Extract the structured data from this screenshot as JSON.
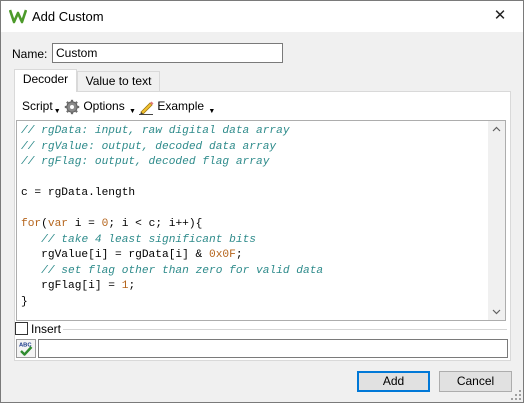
{
  "window": {
    "title": "Add Custom",
    "close_glyph": "✕",
    "app_icon": "waveforms-logo-icon"
  },
  "name_field": {
    "label": "Name:",
    "value": "Custom"
  },
  "tabs": [
    {
      "label": "Decoder",
      "active": true
    },
    {
      "label": "Value to text",
      "active": false
    }
  ],
  "toolbar": {
    "script_label": "Script",
    "options_label": "Options",
    "options_icon": "gear-icon",
    "example_label": "Example",
    "example_icon": "pencil-icon",
    "caret": "▼"
  },
  "code_lines": [
    [
      {
        "t": "// rgData: input, raw digital data array",
        "c": "cm"
      }
    ],
    [
      {
        "t": "// rgValue: output, decoded data array",
        "c": "cm"
      }
    ],
    [
      {
        "t": "// rgFlag: output, decoded flag array",
        "c": "cm"
      }
    ],
    [
      {
        "t": "",
        "c": ""
      }
    ],
    [
      {
        "t": "c = rgData.length",
        "c": ""
      }
    ],
    [
      {
        "t": "",
        "c": ""
      }
    ],
    [
      {
        "t": "for",
        "c": "kw"
      },
      {
        "t": "(",
        "c": ""
      },
      {
        "t": "var",
        "c": "kw"
      },
      {
        "t": " i = ",
        "c": ""
      },
      {
        "t": "0",
        "c": "num"
      },
      {
        "t": "; i < c; i++){",
        "c": ""
      }
    ],
    [
      {
        "t": "   ",
        "c": ""
      },
      {
        "t": "// take 4 least significant bits",
        "c": "cm"
      }
    ],
    [
      {
        "t": "   rgValue[i] = rgData[i] & ",
        "c": ""
      },
      {
        "t": "0x0F",
        "c": "num"
      },
      {
        "t": ";",
        "c": ""
      }
    ],
    [
      {
        "t": "   ",
        "c": ""
      },
      {
        "t": "// set flag other than zero for valid data",
        "c": "cm"
      }
    ],
    [
      {
        "t": "   rgFlag[i] = ",
        "c": ""
      },
      {
        "t": "1",
        "c": "num"
      },
      {
        "t": ";",
        "c": ""
      }
    ],
    [
      {
        "t": "}",
        "c": ""
      }
    ]
  ],
  "insert": {
    "label": "Insert",
    "checked": false
  },
  "spell": {
    "icon": "spellcheck-icon",
    "icon_text": "ABC",
    "value": ""
  },
  "buttons": {
    "add": "Add",
    "cancel": "Cancel"
  },
  "colors": {
    "comment": "#2e8b8b",
    "keyword": "#b5651d",
    "focus": "#0078d7"
  }
}
